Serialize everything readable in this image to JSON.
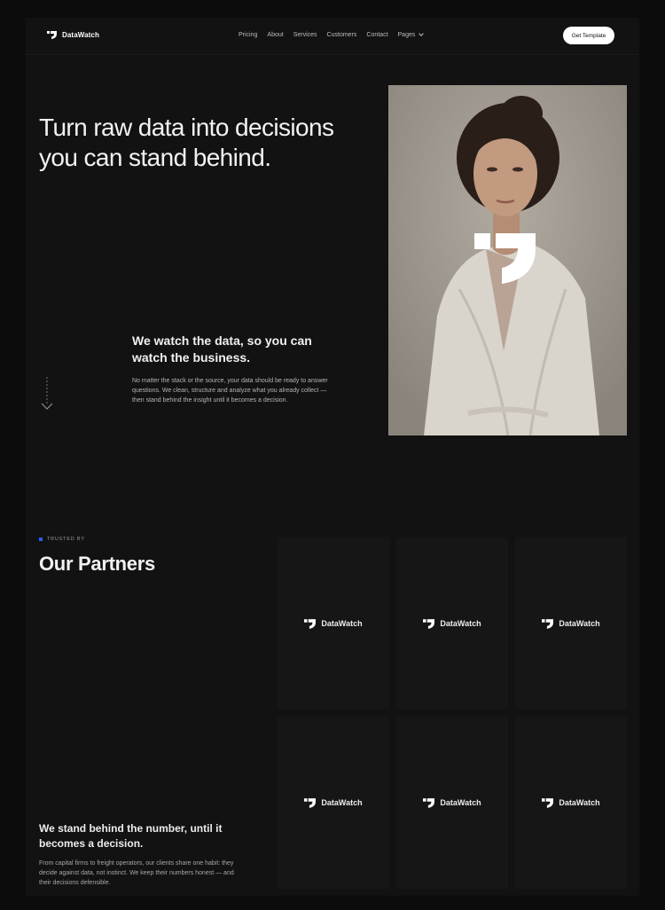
{
  "brand": {
    "name": "DataWatch",
    "logo_icon": "quote-mark-icon"
  },
  "nav": {
    "links": [
      "Pricing",
      "About",
      "Services",
      "Customers",
      "Contact",
      "Pages"
    ],
    "cta": "Get Template"
  },
  "hero": {
    "title": "Turn raw data into decisions you can stand behind.",
    "subheading": "We watch the data, so you can watch the business.",
    "paragraph": "No matter the stack or the source, your data should be ready to answer questions. We clean, structure and analyze what you already collect — then stand behind the insight until it becomes a decision.",
    "image": "portrait-woman-photo"
  },
  "partners": {
    "eyebrow": "TRUSTED BY",
    "title": "Our Partners",
    "logos": [
      "DataWatch",
      "DataWatch",
      "DataWatch",
      "DataWatch",
      "DataWatch",
      "DataWatch"
    ],
    "heading": "We stand behind the number, until it becomes a decision.",
    "paragraph": "From capital firms to freight operators, our clients share one habit: they decide against data, not instinct. We keep their numbers honest — and their decisions defensible."
  },
  "colors": {
    "accent": "#2a5cff",
    "background": "#121212"
  }
}
